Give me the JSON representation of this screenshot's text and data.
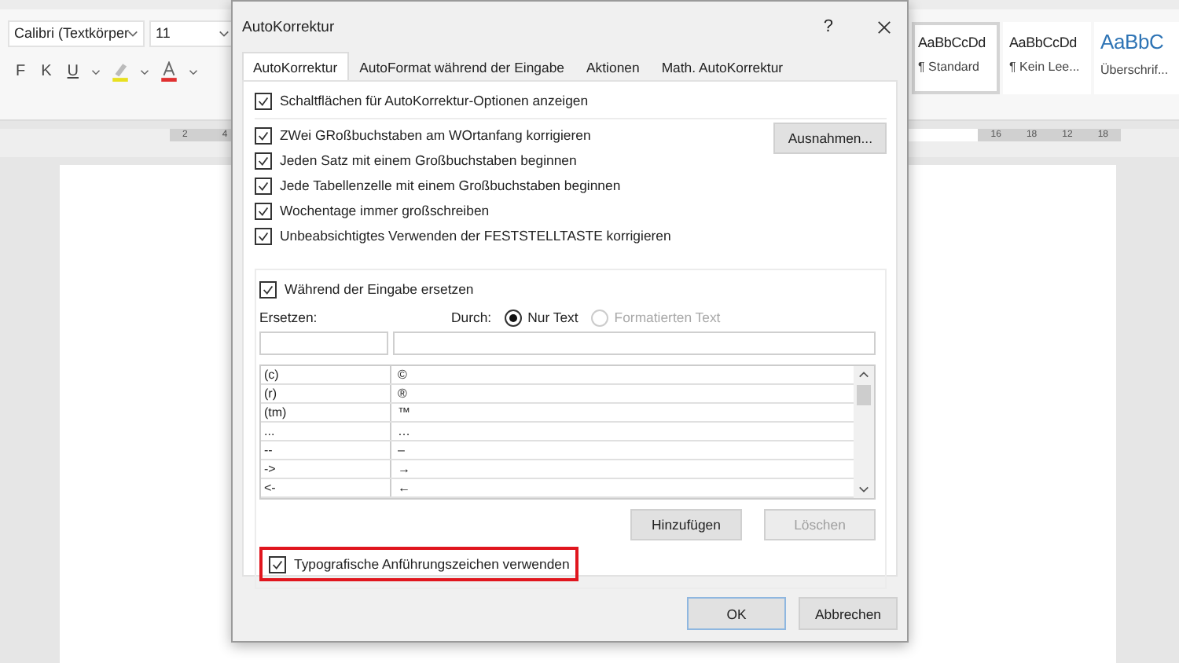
{
  "ribbon": {
    "font_name": "Calibri (Textkörper",
    "font_size": "11",
    "format_buttons": [
      {
        "label": "F",
        "kind": "bold"
      },
      {
        "label": "K",
        "kind": "italic"
      },
      {
        "label": "U",
        "kind": "underline"
      }
    ],
    "styles": [
      {
        "sample": "AaBbCcDd",
        "name": "¶ Standard",
        "selected": true,
        "kind": "normal"
      },
      {
        "sample": "AaBbCcDd",
        "name": "¶ Kein Lee...",
        "selected": false,
        "kind": "normal"
      },
      {
        "sample": "AaBbC",
        "name": "Überschrif...",
        "selected": false,
        "kind": "heading"
      }
    ]
  },
  "ruler": {
    "left_labels": [
      "2",
      "4"
    ],
    "right_labels": [
      "16",
      "18",
      "12",
      "18"
    ]
  },
  "dialog": {
    "title": "AutoKorrektur",
    "help": "?",
    "tabs": [
      {
        "label": "AutoKorrektur",
        "selected": true
      },
      {
        "label": "AutoFormat während der Eingabe",
        "selected": false
      },
      {
        "label": "Aktionen",
        "selected": false
      },
      {
        "label": "Math. AutoKorrektur",
        "selected": false
      }
    ],
    "show_buttons": {
      "label": "Schaltflächen für AutoKorrektur-Optionen anzeigen",
      "checked": true
    },
    "options": [
      {
        "label": "ZWei GRoßbuchstaben am WOrtanfang korrigieren",
        "checked": true
      },
      {
        "label": "Jeden Satz mit einem Großbuchstaben beginnen",
        "checked": true
      },
      {
        "label": "Jede Tabellenzelle mit einem Großbuchstaben beginnen",
        "checked": true
      },
      {
        "label": "Wochentage immer großschreiben",
        "checked": true
      },
      {
        "label": "Unbeabsichtigtes Verwenden der FESTSTELLTASTE korrigieren",
        "checked": true
      }
    ],
    "exceptions_button": "Ausnahmen...",
    "replace_while_typing": {
      "label": "Während der Eingabe ersetzen",
      "checked": true
    },
    "replace_label": "Ersetzen:",
    "with_label": "Durch:",
    "format_options": [
      {
        "label": "Nur Text",
        "selected": true,
        "disabled": false
      },
      {
        "label": "Formatierten Text",
        "selected": false,
        "disabled": true
      }
    ],
    "rows": [
      {
        "replace": "(c)",
        "with": "©"
      },
      {
        "replace": "(r)",
        "with": "®"
      },
      {
        "replace": "(tm)",
        "with": "™"
      },
      {
        "replace": "...",
        "with": "…"
      },
      {
        "replace": "--",
        "with": "–"
      },
      {
        "replace": "->",
        "with": "→"
      },
      {
        "replace": "<-",
        "with": "←"
      }
    ],
    "add_button": {
      "label": "Hinzufügen",
      "disabled": false
    },
    "delete_button": {
      "label": "Löschen",
      "disabled": true
    },
    "smart_quotes": {
      "label": "Typografische Anführungszeichen verwenden",
      "checked": true,
      "highlighted": true
    },
    "ok_button": "OK",
    "cancel_button": "Abbrechen"
  }
}
